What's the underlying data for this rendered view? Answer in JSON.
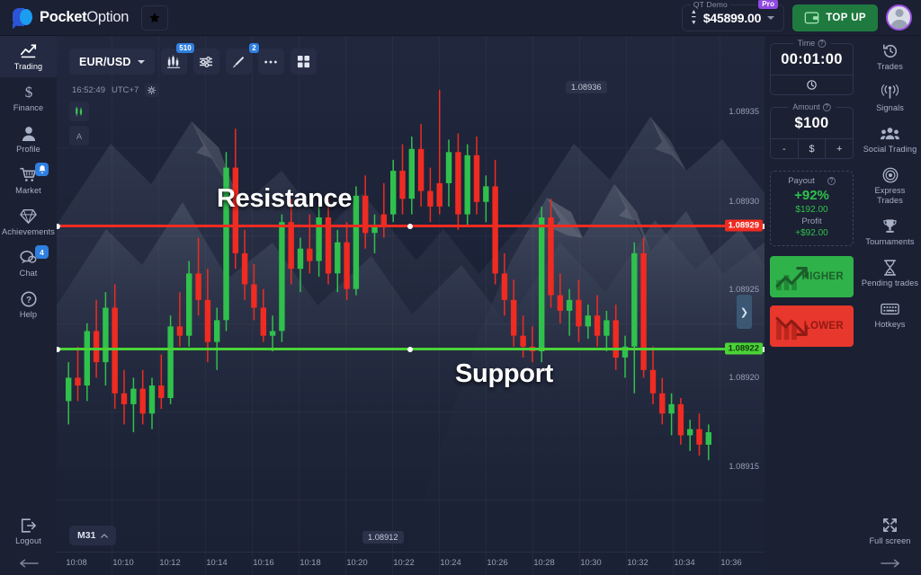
{
  "topbar": {
    "logo_bold": "Pocket",
    "logo_light": "Option",
    "star_icon": "star-icon",
    "account_label": "QT Demo",
    "pro_badge": "Pro",
    "balance": "$45899.00",
    "topup_label": "TOP UP",
    "wallet_icon": "wallet-icon",
    "avatar_icon": "user-avatar"
  },
  "left_sidebar": {
    "items": [
      {
        "label": "Trading",
        "icon": "chart-line-icon",
        "active": true,
        "badge": ""
      },
      {
        "label": "Finance",
        "icon": "dollar-icon",
        "active": false,
        "badge": ""
      },
      {
        "label": "Profile",
        "icon": "user-icon",
        "active": false,
        "badge": ""
      },
      {
        "label": "Market",
        "icon": "cart-icon",
        "active": false,
        "badge": "bell"
      },
      {
        "label": "Achievements",
        "icon": "diamond-icon",
        "active": false,
        "badge": ""
      },
      {
        "label": "Chat",
        "icon": "chat-bubble-icon",
        "active": false,
        "badge": "4"
      },
      {
        "label": "Help",
        "icon": "question-icon",
        "active": false,
        "badge": ""
      }
    ],
    "logout_label": "Logout",
    "logout_icon": "logout-icon",
    "collapse_icon": "arrow-left-icon"
  },
  "right_sidebar": {
    "items": [
      {
        "label": "Trades",
        "icon": "history-icon"
      },
      {
        "label": "Signals",
        "icon": "antenna-icon"
      },
      {
        "label": "Social Trading",
        "icon": "people-icon"
      },
      {
        "label": "Express Trades",
        "icon": "target-icon"
      },
      {
        "label": "Tournaments",
        "icon": "trophy-icon"
      },
      {
        "label": "Pending trades",
        "icon": "hourglass-icon"
      },
      {
        "label": "Hotkeys",
        "icon": "keyboard-icon"
      }
    ],
    "fullscreen_label": "Full screen",
    "fullscreen_icon": "expand-icon",
    "collapse_icon": "arrow-right-icon"
  },
  "chart_toolbar": {
    "pair": "EUR/USD",
    "pair_caret": "chevron-down-icon",
    "buttons": [
      {
        "name": "chart-type-icon",
        "badge": "510"
      },
      {
        "name": "indicators-icon",
        "badge": ""
      },
      {
        "name": "drawing-tool-icon",
        "badge": "2"
      },
      {
        "name": "more-options-icon",
        "badge": ""
      },
      {
        "name": "layout-grid-icon",
        "badge": ""
      }
    ],
    "clock_time": "16:52:49",
    "clock_zone": "UTC+7",
    "settings_icon": "gear-icon",
    "side_tools": [
      {
        "name": "candlestick-tool-icon",
        "glyph": "candles"
      },
      {
        "name": "text-tool-icon",
        "glyph": "A"
      }
    ],
    "timeframe": "M31",
    "timeframe_caret": "chevron-up-icon"
  },
  "trade_panel": {
    "time_legend": "Time",
    "time_value": "00:01:00",
    "time_ctl_icon": "clock-icon",
    "amount_legend": "Amount",
    "amount_value": "$100",
    "amount_minus": "-",
    "amount_currency": "$",
    "amount_plus": "+",
    "payout_label": "Payout",
    "payout_percent": "+92%",
    "payout_amount": "$192.00",
    "profit_label": "Profit",
    "profit_amount": "+$92.00",
    "higher_label": "HIGHER",
    "lower_label": "LOWER",
    "help_icon": "question-icon"
  },
  "annotations": {
    "resistance": "Resistance",
    "support": "Support",
    "resistance_color": "#f02b21",
    "support_color": "#4ad337"
  },
  "chart_data": {
    "type": "candlestick",
    "title": "EUR/USD",
    "xlabel": "",
    "ylabel": "",
    "timeframe": "M31",
    "grid": true,
    "ylim": [
      1.0891,
      1.08938
    ],
    "price_ticks": [
      "1.08935",
      "1.08930",
      "1.08925",
      "1.08920",
      "1.08915"
    ],
    "time_ticks": [
      "10:08",
      "10:10",
      "10:12",
      "10:14",
      "10:16",
      "10:18",
      "10:20",
      "10:22",
      "10:24",
      "10:26",
      "10:28",
      "10:30",
      "10:32",
      "10:34",
      "10:36"
    ],
    "markers": [
      {
        "label": "1.08936",
        "type": "high-marker"
      },
      {
        "label": "1.08912",
        "type": "low-marker"
      }
    ],
    "levels": [
      {
        "name": "resistance",
        "price": "1.08929",
        "color": "#f02b21"
      },
      {
        "name": "support",
        "price": "1.08922",
        "color": "#4ad337"
      }
    ],
    "up_color": "#2fc14c",
    "down_color": "#f02b21",
    "candles": [
      {
        "o": 1.08918,
        "h": 1.089205,
        "l": 1.089165,
        "c": 1.089195,
        "d": 1
      },
      {
        "o": 1.089195,
        "h": 1.089215,
        "l": 1.08918,
        "c": 1.08919,
        "d": 0
      },
      {
        "o": 1.08919,
        "h": 1.08923,
        "l": 1.08918,
        "c": 1.089225,
        "d": 1
      },
      {
        "o": 1.089225,
        "h": 1.089245,
        "l": 1.089195,
        "c": 1.089205,
        "d": 0
      },
      {
        "o": 1.089205,
        "h": 1.08925,
        "l": 1.08919,
        "c": 1.08924,
        "d": 1
      },
      {
        "o": 1.08924,
        "h": 1.089255,
        "l": 1.089175,
        "c": 1.089185,
        "d": 0
      },
      {
        "o": 1.089185,
        "h": 1.0892,
        "l": 1.089165,
        "c": 1.089178,
        "d": 0
      },
      {
        "o": 1.089178,
        "h": 1.089195,
        "l": 1.08916,
        "c": 1.089188,
        "d": 1
      },
      {
        "o": 1.089188,
        "h": 1.0892,
        "l": 1.089165,
        "c": 1.089172,
        "d": 0
      },
      {
        "o": 1.089172,
        "h": 1.089195,
        "l": 1.089162,
        "c": 1.08919,
        "d": 1
      },
      {
        "o": 1.08919,
        "h": 1.08921,
        "l": 1.089175,
        "c": 1.089182,
        "d": 0
      },
      {
        "o": 1.089182,
        "h": 1.089235,
        "l": 1.089178,
        "c": 1.089228,
        "d": 1
      },
      {
        "o": 1.089228,
        "h": 1.08925,
        "l": 1.089215,
        "c": 1.089222,
        "d": 0
      },
      {
        "o": 1.089222,
        "h": 1.08927,
        "l": 1.089215,
        "c": 1.089262,
        "d": 1
      },
      {
        "o": 1.089262,
        "h": 1.089285,
        "l": 1.089235,
        "c": 1.089245,
        "d": 0
      },
      {
        "o": 1.089245,
        "h": 1.089265,
        "l": 1.089205,
        "c": 1.089218,
        "d": 0
      },
      {
        "o": 1.089218,
        "h": 1.08924,
        "l": 1.0892,
        "c": 1.089232,
        "d": 1
      },
      {
        "o": 1.089232,
        "h": 1.08934,
        "l": 1.089225,
        "c": 1.08933,
        "d": 1
      },
      {
        "o": 1.08933,
        "h": 1.089355,
        "l": 1.089265,
        "c": 1.089275,
        "d": 0
      },
      {
        "o": 1.089275,
        "h": 1.08929,
        "l": 1.089245,
        "c": 1.089255,
        "d": 0
      },
      {
        "o": 1.089255,
        "h": 1.089268,
        "l": 1.089232,
        "c": 1.08924,
        "d": 0
      },
      {
        "o": 1.08924,
        "h": 1.089252,
        "l": 1.089218,
        "c": 1.089222,
        "d": 0
      },
      {
        "o": 1.089222,
        "h": 1.089235,
        "l": 1.089212,
        "c": 1.089225,
        "d": 1
      },
      {
        "o": 1.089225,
        "h": 1.0893,
        "l": 1.089218,
        "c": 1.089295,
        "d": 1
      },
      {
        "o": 1.089295,
        "h": 1.08931,
        "l": 1.089255,
        "c": 1.089265,
        "d": 0
      },
      {
        "o": 1.089265,
        "h": 1.089285,
        "l": 1.08925,
        "c": 1.089278,
        "d": 1
      },
      {
        "o": 1.089278,
        "h": 1.0893,
        "l": 1.089262,
        "c": 1.08927,
        "d": 0
      },
      {
        "o": 1.08927,
        "h": 1.089305,
        "l": 1.08926,
        "c": 1.089298,
        "d": 1
      },
      {
        "o": 1.089298,
        "h": 1.08931,
        "l": 1.089255,
        "c": 1.089262,
        "d": 0
      },
      {
        "o": 1.089262,
        "h": 1.08929,
        "l": 1.08925,
        "c": 1.089282,
        "d": 1
      },
      {
        "o": 1.089282,
        "h": 1.089295,
        "l": 1.089245,
        "c": 1.089252,
        "d": 0
      },
      {
        "o": 1.089252,
        "h": 1.089318,
        "l": 1.089248,
        "c": 1.089312,
        "d": 1
      },
      {
        "o": 1.089312,
        "h": 1.089325,
        "l": 1.089278,
        "c": 1.089288,
        "d": 0
      },
      {
        "o": 1.089288,
        "h": 1.0893,
        "l": 1.089275,
        "c": 1.089292,
        "d": 1
      },
      {
        "o": 1.089292,
        "h": 1.08932,
        "l": 1.089285,
        "c": 1.0893,
        "d": 0
      },
      {
        "o": 1.0893,
        "h": 1.089335,
        "l": 1.089295,
        "c": 1.089328,
        "d": 1
      },
      {
        "o": 1.089328,
        "h": 1.089345,
        "l": 1.0893,
        "c": 1.08931,
        "d": 0
      },
      {
        "o": 1.08931,
        "h": 1.08935,
        "l": 1.0893,
        "c": 1.089342,
        "d": 1
      },
      {
        "o": 1.089342,
        "h": 1.089358,
        "l": 1.089305,
        "c": 1.089315,
        "d": 0
      },
      {
        "o": 1.089315,
        "h": 1.08933,
        "l": 1.089295,
        "c": 1.089305,
        "d": 0
      },
      {
        "o": 1.089305,
        "h": 1.08938,
        "l": 1.0893,
        "c": 1.08932,
        "d": 0
      },
      {
        "o": 1.08932,
        "h": 1.089348,
        "l": 1.089305,
        "c": 1.08934,
        "d": 1
      },
      {
        "o": 1.08934,
        "h": 1.089352,
        "l": 1.08929,
        "c": 1.0893,
        "d": 0
      },
      {
        "o": 1.0893,
        "h": 1.089345,
        "l": 1.089292,
        "c": 1.089338,
        "d": 1
      },
      {
        "o": 1.089338,
        "h": 1.08935,
        "l": 1.0893,
        "c": 1.089308,
        "d": 0
      },
      {
        "o": 1.089308,
        "h": 1.089325,
        "l": 1.089295,
        "c": 1.089318,
        "d": 1
      },
      {
        "o": 1.089318,
        "h": 1.089335,
        "l": 1.089255,
        "c": 1.089262,
        "d": 0
      },
      {
        "o": 1.089262,
        "h": 1.089275,
        "l": 1.089235,
        "c": 1.089245,
        "d": 0
      },
      {
        "o": 1.089245,
        "h": 1.089258,
        "l": 1.089215,
        "c": 1.089222,
        "d": 0
      },
      {
        "o": 1.089222,
        "h": 1.089235,
        "l": 1.089208,
        "c": 1.089215,
        "d": 0
      },
      {
        "o": 1.089215,
        "h": 1.089228,
        "l": 1.089205,
        "c": 1.089212,
        "d": 0
      },
      {
        "o": 1.089212,
        "h": 1.089305,
        "l": 1.089205,
        "c": 1.089298,
        "d": 1
      },
      {
        "o": 1.089298,
        "h": 1.08931,
        "l": 1.08924,
        "c": 1.089248,
        "d": 0
      },
      {
        "o": 1.089248,
        "h": 1.089262,
        "l": 1.08923,
        "c": 1.089238,
        "d": 0
      },
      {
        "o": 1.089238,
        "h": 1.089252,
        "l": 1.089222,
        "c": 1.089245,
        "d": 1
      },
      {
        "o": 1.089245,
        "h": 1.089258,
        "l": 1.089218,
        "c": 1.089228,
        "d": 0
      },
      {
        "o": 1.089228,
        "h": 1.089242,
        "l": 1.08922,
        "c": 1.089235,
        "d": 1
      },
      {
        "o": 1.089235,
        "h": 1.089248,
        "l": 1.089215,
        "c": 1.089222,
        "d": 0
      },
      {
        "o": 1.089222,
        "h": 1.089238,
        "l": 1.089212,
        "c": 1.089232,
        "d": 1
      },
      {
        "o": 1.089232,
        "h": 1.089242,
        "l": 1.0892,
        "c": 1.089208,
        "d": 0
      },
      {
        "o": 1.089208,
        "h": 1.089222,
        "l": 1.089195,
        "c": 1.089215,
        "d": 1
      },
      {
        "o": 1.089215,
        "h": 1.089282,
        "l": 1.089185,
        "c": 1.089275,
        "d": 1
      },
      {
        "o": 1.089275,
        "h": 1.089285,
        "l": 1.089195,
        "c": 1.0892,
        "d": 0
      },
      {
        "o": 1.0892,
        "h": 1.089215,
        "l": 1.089178,
        "c": 1.089185,
        "d": 0
      },
      {
        "o": 1.089185,
        "h": 1.089195,
        "l": 1.089165,
        "c": 1.089172,
        "d": 0
      },
      {
        "o": 1.089172,
        "h": 1.089185,
        "l": 1.089158,
        "c": 1.089178,
        "d": 1
      },
      {
        "o": 1.089178,
        "h": 1.089182,
        "l": 1.089152,
        "c": 1.089158,
        "d": 0
      },
      {
        "o": 1.089158,
        "h": 1.089168,
        "l": 1.089148,
        "c": 1.089162,
        "d": 1
      },
      {
        "o": 1.089162,
        "h": 1.089172,
        "l": 1.089145,
        "c": 1.089152,
        "d": 0
      },
      {
        "o": 1.089152,
        "h": 1.089165,
        "l": 1.089142,
        "c": 1.08916,
        "d": 1
      }
    ]
  }
}
